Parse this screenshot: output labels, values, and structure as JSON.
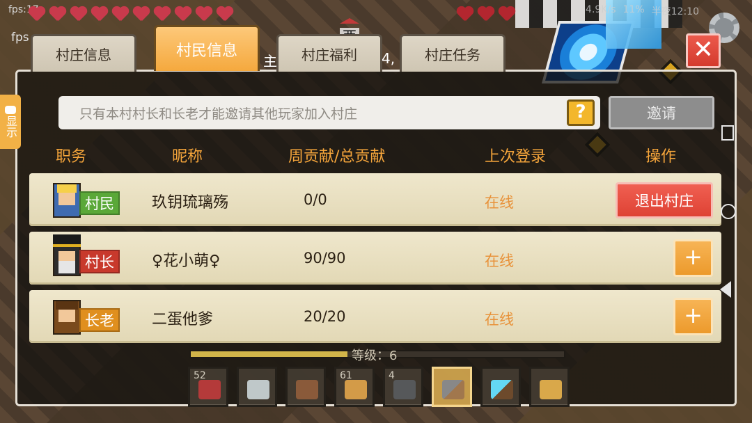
{
  "hud": {
    "fps_top": "fps:17",
    "fps_second": "fps",
    "status_left": "4.9K/s",
    "status_battery": "11%",
    "status_time": "半夜12:10",
    "compass_direction": "西",
    "behind_text_1": "主",
    "behind_text_2": "4,"
  },
  "tabs": [
    {
      "label": "村庄信息"
    },
    {
      "label": "村民信息"
    },
    {
      "label": "村庄福利"
    },
    {
      "label": "村庄任务"
    }
  ],
  "close_label": "✕",
  "side_tab": {
    "label": "显示"
  },
  "invite": {
    "placeholder": "只有本村村长和长老才能邀请其他玩家加入村庄",
    "help_label": "?",
    "button_label": "邀请"
  },
  "columns": {
    "role": "职务",
    "nickname": "昵称",
    "contribution": "周贡献/总贡献",
    "last_login": "上次登录",
    "action": "操作"
  },
  "members": [
    {
      "role": "村民",
      "name": "玖钥琉璃殇",
      "contribution": "0/0",
      "status": "在线",
      "action": "退出村庄"
    },
    {
      "role": "村长",
      "name": "♀花小萌♀",
      "contribution": "90/90",
      "status": "在线",
      "action": "+"
    },
    {
      "role": "长老",
      "name": "二蛋他爹",
      "contribution": "20/20",
      "status": "在线",
      "action": "+"
    }
  ],
  "level": {
    "label": "等级：6",
    "progress": 0.42
  },
  "hotbar": [
    {
      "count": "52",
      "icon": "meat-icon"
    },
    {
      "count": "",
      "icon": "map-icon"
    },
    {
      "count": "",
      "icon": "hammer-icon"
    },
    {
      "count": "61",
      "icon": "potato-icon"
    },
    {
      "count": "4",
      "icon": "stone-block-icon"
    },
    {
      "count": "",
      "icon": "pickaxe-icon"
    },
    {
      "count": "",
      "icon": "diamond-pickaxe-icon"
    },
    {
      "count": "",
      "icon": "backpack-icon"
    }
  ],
  "colors": {
    "accent_orange": "#f5a53b",
    "online_orange": "#e8923a",
    "quit_red": "#de4234",
    "row_bg": "#efe7cc"
  }
}
